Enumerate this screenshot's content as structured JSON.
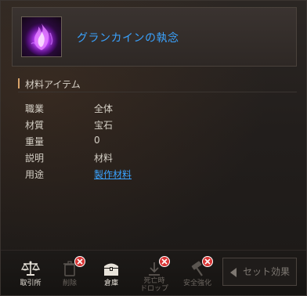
{
  "item": {
    "name": "グランカインの執念",
    "icon": "purple-flame-crystal-icon"
  },
  "section": {
    "title": "材料アイテム"
  },
  "attributes": [
    {
      "label": "職業",
      "value": "全体"
    },
    {
      "label": "材質",
      "value": "宝石"
    },
    {
      "label": "重量",
      "value": "0"
    },
    {
      "label": "説明",
      "value": "材料"
    },
    {
      "label": "用途",
      "value": "製作材料"
    }
  ],
  "footer": {
    "exchange": "取引所",
    "delete": "削除",
    "storage": "倉庫",
    "death_drop": "死亡時\nドロップ",
    "safe_enhance": "安全強化",
    "set_effect": "セット効果"
  },
  "colors": {
    "accent_blue": "#3aa3ff",
    "disabled_red": "#d83535"
  }
}
